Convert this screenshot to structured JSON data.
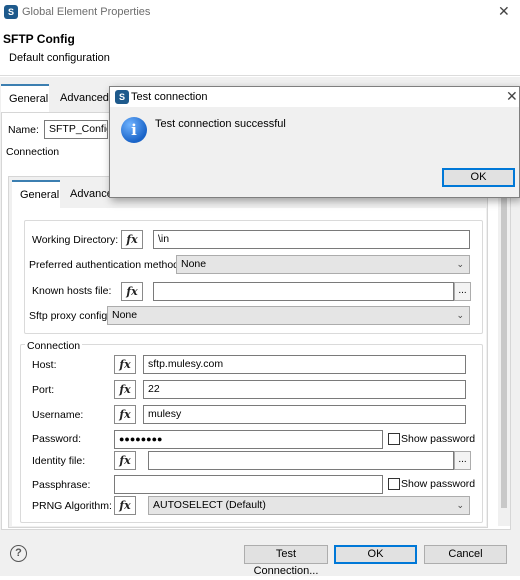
{
  "window": {
    "title": "Global Element Properties",
    "close_glyph": "✕",
    "app_icon_glyph": "S"
  },
  "header": {
    "title": "SFTP Config",
    "subtitle": "Default configuration"
  },
  "outer_tabs": [
    {
      "label": "General",
      "active": true
    },
    {
      "label": "Advanced",
      "active": false
    }
  ],
  "name_field": {
    "label": "Name:",
    "value": "SFTP_Config"
  },
  "connection_label": "Connection",
  "inner_tabs": [
    {
      "label": "General",
      "active": true
    },
    {
      "label": "Advanced",
      "active": false
    }
  ],
  "fx_glyph": "fx",
  "settings": {
    "working_directory": {
      "label": "Working Directory:",
      "value": "\\in"
    },
    "preferred_auth": {
      "label": "Preferred authentication methods",
      "value": "None"
    },
    "known_hosts": {
      "label": "Known hosts file:",
      "value": "",
      "browse": "..."
    },
    "sftp_proxy": {
      "label": "Sftp proxy config",
      "value": "None"
    }
  },
  "connection_group": {
    "title": "Connection",
    "host": {
      "label": "Host:",
      "value": "sftp.mulesy.com"
    },
    "port": {
      "label": "Port:",
      "value": "22"
    },
    "username": {
      "label": "Username:",
      "value": "mulesy"
    },
    "password": {
      "label": "Password:",
      "value": "●●●●●●●●",
      "show_label": "Show password"
    },
    "identity_file": {
      "label": "Identity file:",
      "value": "",
      "browse": "..."
    },
    "passphrase": {
      "label": "Passphrase:",
      "value": "",
      "show_label": "Show password"
    },
    "prng": {
      "label": "PRNG Algorithm:",
      "value": "AUTOSELECT (Default)"
    }
  },
  "footer": {
    "help_glyph": "?",
    "test_connection": "Test Connection...",
    "ok": "OK",
    "cancel": "Cancel"
  },
  "dialog": {
    "title": "Test connection",
    "close_glyph": "✕",
    "icon_glyph": "i",
    "message": "Test connection successful",
    "ok": "OK"
  },
  "colors": {
    "accent": "#0078d7",
    "tab_accent": "#3c7fb1",
    "background": "#f0f0f0"
  }
}
